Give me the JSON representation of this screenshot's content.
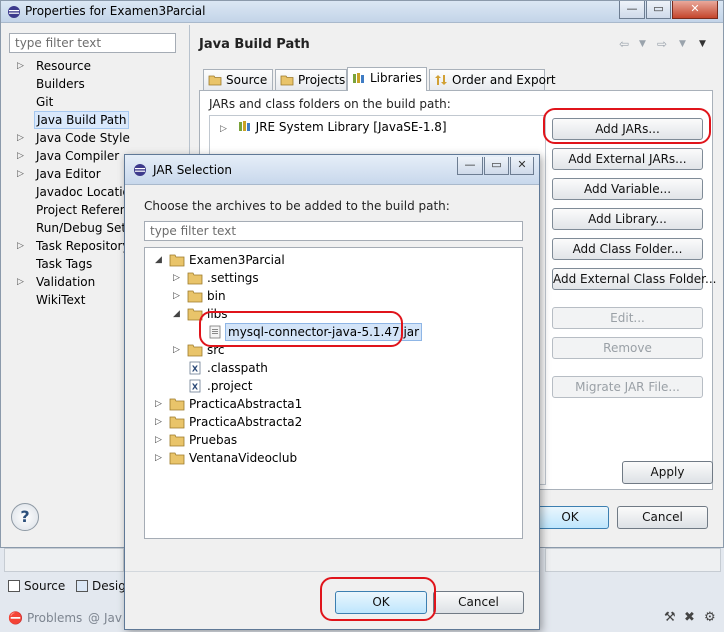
{
  "outer_window": {
    "title": "Properties for Examen3Parcial",
    "filter_placeholder": "type filter text",
    "nav_items": [
      {
        "label": "Resource",
        "expandable": true
      },
      {
        "label": "Builders",
        "expandable": false
      },
      {
        "label": "Git",
        "expandable": false
      },
      {
        "label": "Java Build Path",
        "expandable": false,
        "selected": true
      },
      {
        "label": "Java Code Style",
        "expandable": true
      },
      {
        "label": "Java Compiler",
        "expandable": true
      },
      {
        "label": "Java Editor",
        "expandable": true
      },
      {
        "label": "Javadoc Location",
        "expandable": false
      },
      {
        "label": "Project References",
        "expandable": false
      },
      {
        "label": "Run/Debug Settings",
        "expandable": false
      },
      {
        "label": "Task Repository",
        "expandable": true
      },
      {
        "label": "Task Tags",
        "expandable": false
      },
      {
        "label": "Validation",
        "expandable": true
      },
      {
        "label": "WikiText",
        "expandable": false
      }
    ],
    "header_title": "Java Build Path",
    "tabs": [
      {
        "label": "Source"
      },
      {
        "label": "Projects"
      },
      {
        "label": "Libraries",
        "active": true
      },
      {
        "label": "Order and Export"
      }
    ],
    "jar_label": "JARs and class folders on the build path:",
    "library_entry": "JRE System Library [JavaSE-1.8]",
    "buttons": {
      "add_jars": "Add JARs...",
      "add_external_jars": "Add External JARs...",
      "add_variable": "Add Variable...",
      "add_library": "Add Library...",
      "add_class_folder": "Add Class Folder...",
      "add_external_class_folder": "Add External Class Folder...",
      "edit": "Edit...",
      "remove": "Remove",
      "migrate_jar": "Migrate JAR File...",
      "apply": "Apply",
      "ok": "OK",
      "cancel": "Cancel"
    }
  },
  "bottom_bar": {
    "tabs": [
      {
        "label": "Source"
      },
      {
        "label": "Design"
      }
    ],
    "views": [
      {
        "label": "Problems"
      },
      {
        "label": "Jav"
      }
    ]
  },
  "jar_dialog": {
    "title": "JAR Selection",
    "instruction": "Choose the archives to be added to the build path:",
    "filter_placeholder": "type filter text",
    "tree": {
      "root": "Examen3Parcial",
      "settings": ".settings",
      "bin": "bin",
      "libs": "libs",
      "jar": "mysql-connector-java-5.1.47.jar",
      "src": "src",
      "classpath": ".classpath",
      "project": ".project",
      "practica1": "PracticaAbstracta1",
      "practica2": "PracticaAbstracta2",
      "pruebas": "Pruebas",
      "ventana": "VentanaVideoclub"
    },
    "ok_label": "OK",
    "cancel_label": "Cancel"
  },
  "colors": {
    "highlight": "#e0141b",
    "selection": "#d3e4f8",
    "folder": "#e9c46a"
  }
}
